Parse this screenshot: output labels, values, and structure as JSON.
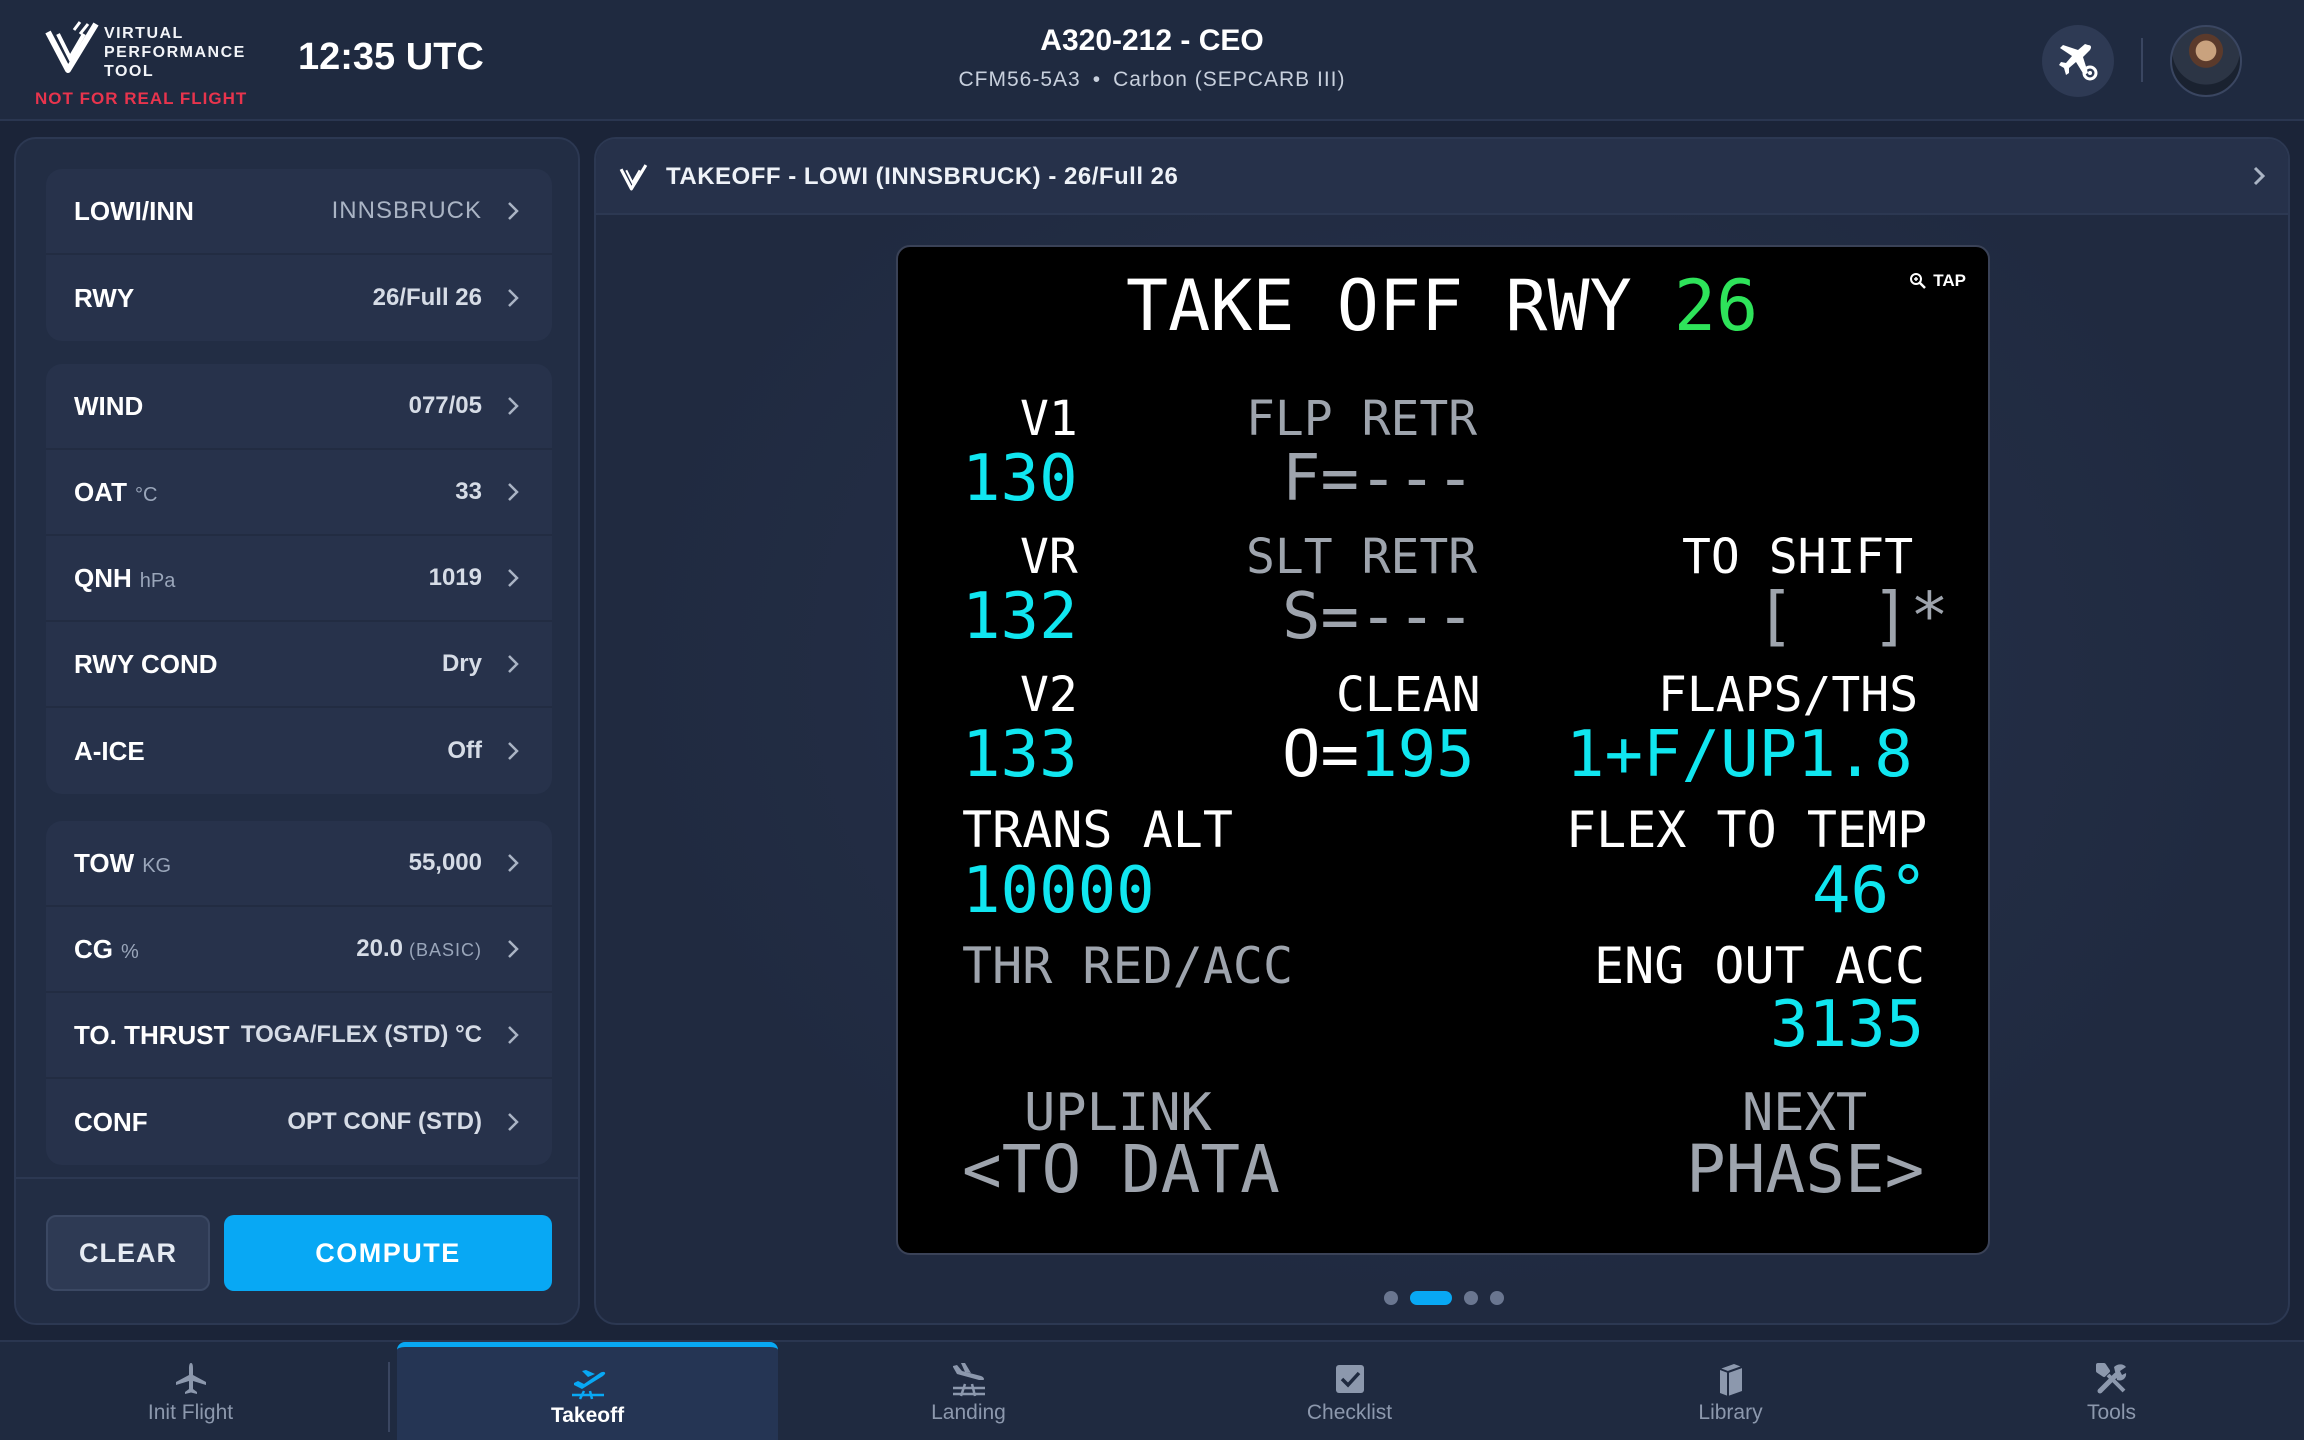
{
  "header": {
    "logo_lines": [
      "VIRTUAL",
      "PERFORMANCE",
      "TOOL"
    ],
    "warning": "NOT FOR REAL FLIGHT",
    "clock": "12:35 UTC",
    "aircraft": "A320-212 - CEO",
    "engine": "CFM56-5A3",
    "brakes": "Carbon (SEPCARB III)",
    "separator": "•"
  },
  "left": {
    "airport": [
      {
        "label": "LOWI/INN",
        "value": "INNSBRUCK",
        "light": true
      },
      {
        "label": "RWY",
        "value": "26/Full 26"
      }
    ],
    "conditions": [
      {
        "label": "WIND",
        "unit": "",
        "value": "077/05"
      },
      {
        "label": "OAT",
        "unit": "°C",
        "value": "33"
      },
      {
        "label": "QNH",
        "unit": "hPa",
        "value": "1019"
      },
      {
        "label": "RWY COND",
        "unit": "",
        "value": "Dry"
      },
      {
        "label": "A-ICE",
        "unit": "",
        "value": "Off"
      }
    ],
    "aircraft": [
      {
        "label": "TOW",
        "unit": "KG",
        "value": "55,000",
        "sub": ""
      },
      {
        "label": "CG",
        "unit": "%",
        "value": "20.0",
        "sub": "(BASIC)"
      },
      {
        "label": "TO. THRUST",
        "unit": "",
        "value": "TOGA/FLEX (STD) °C",
        "sub": ""
      },
      {
        "label": "CONF",
        "unit": "",
        "value": "OPT CONF (STD)",
        "sub": ""
      }
    ],
    "clear_label": "CLEAR",
    "compute_label": "COMPUTE"
  },
  "right": {
    "title": "TAKEOFF - LOWI (INNSBRUCK) - 26/Full 26",
    "tap_label": "TAP",
    "mcdu": {
      "title": "TAKE OFF RWY",
      "runway": "26",
      "v1_label": "V1",
      "v1": "130",
      "vr_label": "VR",
      "vr": "132",
      "v2_label": "V2",
      "v2": "133",
      "flp_retr_label": "FLP RETR",
      "flp_retr": "F=---",
      "slt_retr_label": "SLT RETR",
      "slt_retr": "S=---",
      "clean_label": "CLEAN",
      "clean_prefix": "O=",
      "clean": "195",
      "to_shift_label": "TO SHIFT",
      "to_shift": "[  ]*",
      "flaps_ths_label": "FLAPS/THS",
      "flaps_ths": "1+F/UP1.8",
      "trans_alt_label": "TRANS ALT",
      "trans_alt": "10000",
      "flex_label": "FLEX TO TEMP",
      "flex": "46°",
      "thr_red_label": "THR RED/ACC",
      "eng_out_label": "ENG OUT ACC",
      "eng_out": "3135",
      "uplink_1": "UPLINK",
      "uplink_2": "<TO DATA",
      "next_1": "NEXT",
      "next_2": "PHASE>"
    },
    "pages": 4,
    "active_page": 2
  },
  "nav": [
    {
      "label": "Init Flight",
      "icon": "airplane-icon"
    },
    {
      "label": "Takeoff",
      "icon": "takeoff-icon"
    },
    {
      "label": "Landing",
      "icon": "landing-icon"
    },
    {
      "label": "Checklist",
      "icon": "checklist-icon"
    },
    {
      "label": "Library",
      "icon": "library-icon"
    },
    {
      "label": "Tools",
      "icon": "tools-icon"
    }
  ],
  "colors": {
    "accent": "#08a8f4",
    "warning": "#e8344d",
    "mcdu_cyan": "#10e6f0",
    "mcdu_green": "#2ee35a"
  }
}
